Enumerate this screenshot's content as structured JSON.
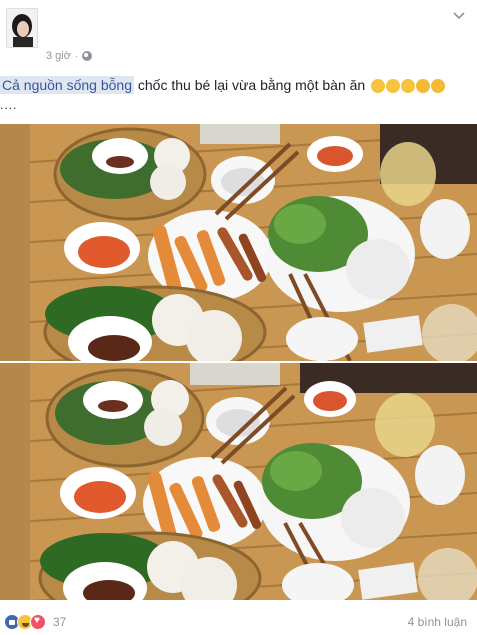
{
  "post": {
    "timestamp": "3 giờ",
    "privacy_icon": "globe-icon",
    "menu_icon": "chevron-down-icon",
    "caption": {
      "highlight": "Cả nguồn sống bỗng",
      "rest": " chốc thu bé lại vừa bằng một bàn ăn",
      "emojis": [
        "laughing-emoji",
        "laughing-emoji",
        "laughing-emoji",
        "kissing-emoji",
        "winking-tongue-emoji"
      ],
      "more": "...."
    },
    "photos": [
      {
        "alt_name": "food-table-photo"
      },
      {
        "alt_name": "food-table-photo"
      }
    ],
    "reactions": {
      "icons": [
        "like-icon",
        "haha-icon",
        "love-icon"
      ],
      "count": "37"
    },
    "comments": "4 bình luận"
  }
}
